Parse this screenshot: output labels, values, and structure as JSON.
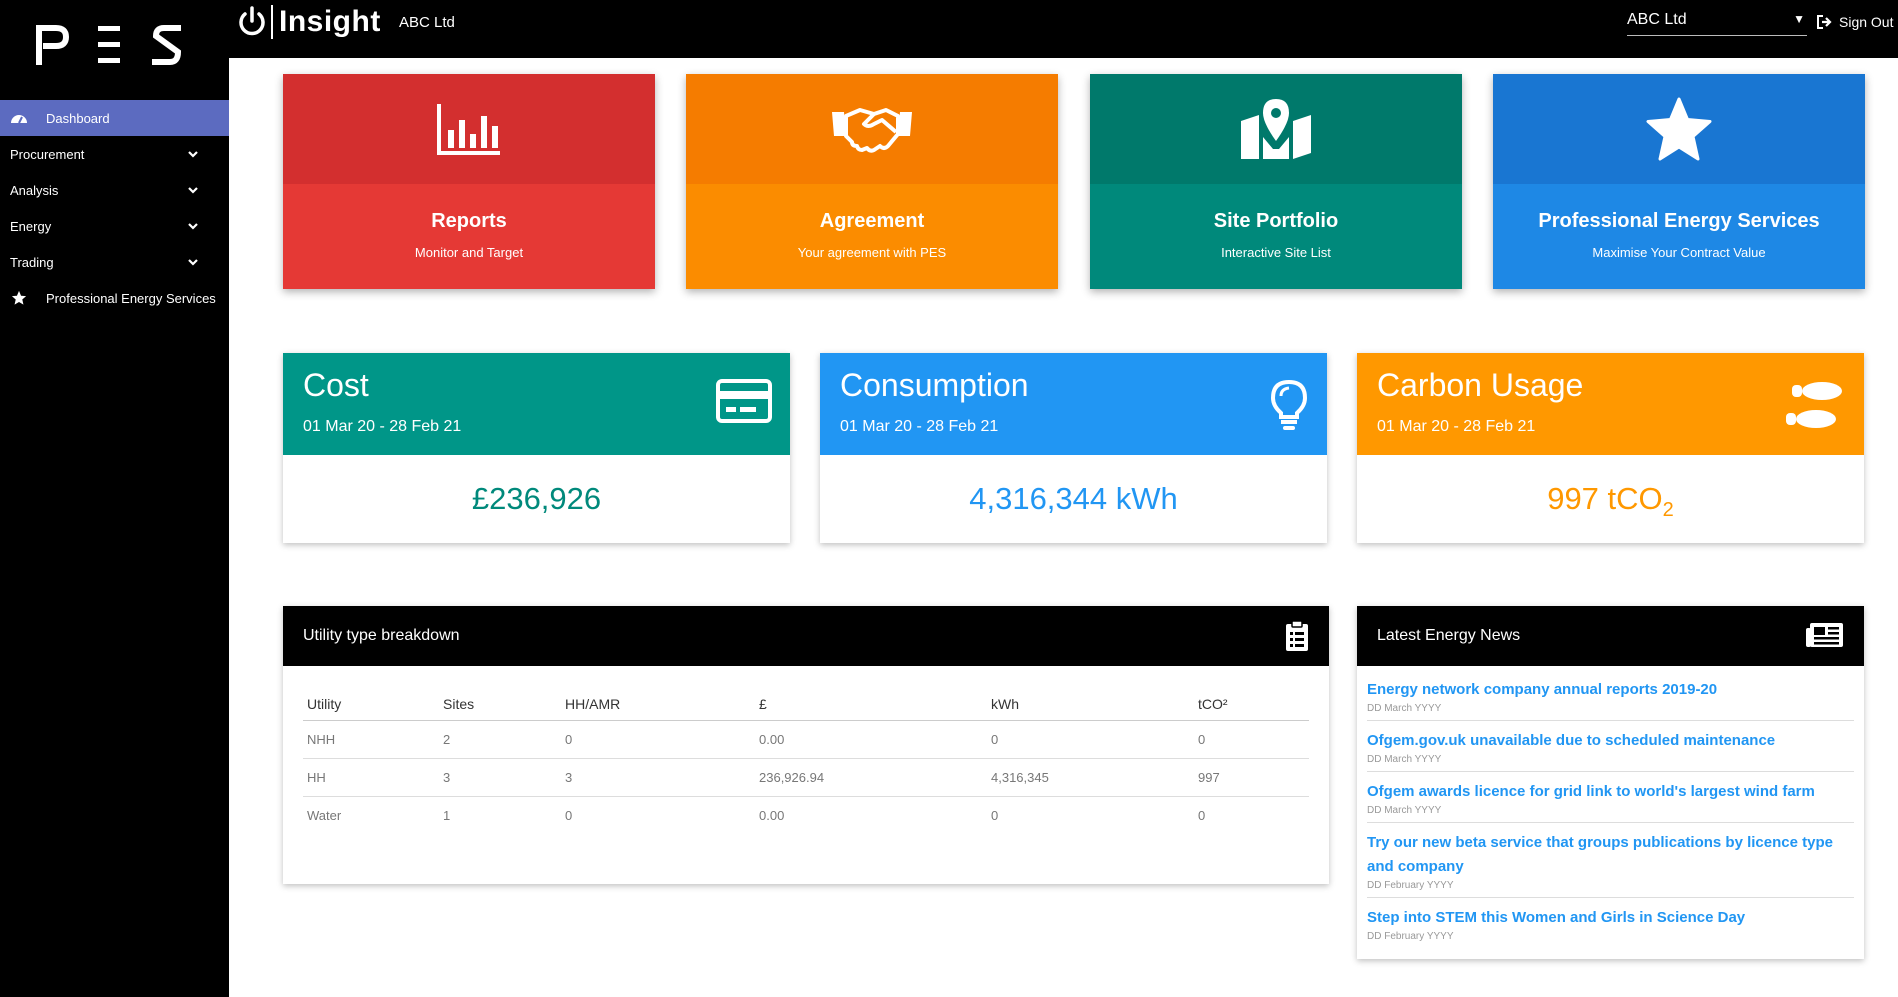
{
  "app": {
    "logo_text": "PES",
    "brand": "Insight",
    "company": "ABC Ltd"
  },
  "header": {
    "company_select": {
      "value": "ABC Ltd"
    },
    "signout_label": "Sign Out"
  },
  "sidebar": {
    "items": [
      {
        "label": "Dashboard",
        "icon": "speedometer-icon",
        "active": true
      },
      {
        "label": "Procurement",
        "icon": "chevron-down-icon"
      },
      {
        "label": "Analysis",
        "icon": "chevron-down-icon"
      },
      {
        "label": "Energy",
        "icon": "chevron-down-icon"
      },
      {
        "label": "Trading",
        "icon": "chevron-down-icon"
      },
      {
        "label": "Professional Energy Services",
        "icon": "star-icon"
      }
    ]
  },
  "tiles": [
    {
      "title": "Reports",
      "subtitle": "Monitor and Target",
      "icon": "bar-chart-icon",
      "top_color": "#d32f2f",
      "bottom_color": "#e53935"
    },
    {
      "title": "Agreement",
      "subtitle": "Your agreement with PES",
      "icon": "handshake-icon",
      "top_color": "#f57c00",
      "bottom_color": "#fb8c00"
    },
    {
      "title": "Site Portfolio",
      "subtitle": "Interactive Site List",
      "icon": "map-marker-icon",
      "top_color": "#00796b",
      "bottom_color": "#00897b"
    },
    {
      "title": "Professional Energy Services",
      "subtitle": "Maximise Your Contract Value",
      "icon": "star-icon",
      "top_color": "#1976d2",
      "bottom_color": "#1e88e5"
    }
  ],
  "stats": [
    {
      "title": "Cost",
      "range": "01 Mar 20 - 28 Feb 21",
      "value": "£236,926",
      "icon": "credit-card-icon",
      "color": "#009688"
    },
    {
      "title": "Consumption",
      "range": "01 Mar 20 - 28 Feb 21",
      "value": "4,316,344 kWh",
      "icon": "lightbulb-icon",
      "color": "#2196f3"
    },
    {
      "title": "Carbon Usage",
      "range": "01 Mar 20 - 28 Feb 21",
      "value": "997 tCO",
      "value_sub": "2",
      "icon": "footprints-icon",
      "color": "#ff9800"
    }
  ],
  "utility": {
    "title": "Utility type breakdown",
    "columns": [
      "Utility",
      "Sites",
      "HH/AMR",
      "£",
      "kWh",
      "tCO²"
    ],
    "rows": [
      [
        "NHH",
        "2",
        "0",
        "0.00",
        "0",
        "0"
      ],
      [
        "HH",
        "3",
        "3",
        "236,926.94",
        "4,316,345",
        "997"
      ],
      [
        "Water",
        "1",
        "0",
        "0.00",
        "0",
        "0"
      ]
    ]
  },
  "news": {
    "title": "Latest Energy News",
    "items": [
      {
        "title": "Energy network company annual reports 2019-20",
        "date": "DD March YYYY"
      },
      {
        "title": "Ofgem.gov.uk unavailable due to scheduled maintenance",
        "date": "DD March YYYY"
      },
      {
        "title": "Ofgem awards licence for grid link to world's largest wind farm",
        "date": "DD March YYYY"
      },
      {
        "title": "Try our new beta service that groups publications by licence type and company",
        "date": "DD February YYYY"
      },
      {
        "title": "Step into STEM this Women and Girls in Science Day",
        "date": "DD February YYYY"
      }
    ]
  }
}
